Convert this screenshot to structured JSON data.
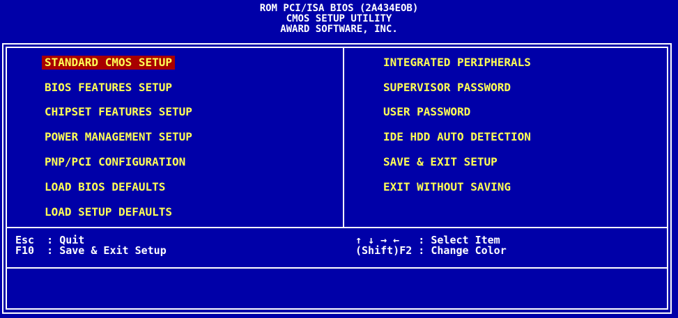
{
  "header": {
    "line1": "ROM PCI/ISA BIOS (2A434EOB)",
    "line2": "CMOS SETUP UTILITY",
    "line3": "AWARD SOFTWARE, INC."
  },
  "menu": {
    "left": [
      {
        "label": "STANDARD CMOS SETUP",
        "selected": true
      },
      {
        "label": "BIOS FEATURES SETUP"
      },
      {
        "label": "CHIPSET FEATURES SETUP"
      },
      {
        "label": "POWER MANAGEMENT SETUP"
      },
      {
        "label": "PNP/PCI CONFIGURATION"
      },
      {
        "label": "LOAD BIOS DEFAULTS"
      },
      {
        "label": "LOAD SETUP DEFAULTS"
      }
    ],
    "right": [
      {
        "label": "INTEGRATED PERIPHERALS"
      },
      {
        "label": "SUPERVISOR PASSWORD"
      },
      {
        "label": "USER PASSWORD"
      },
      {
        "label": "IDE HDD AUTO DETECTION"
      },
      {
        "label": "SAVE & EXIT SETUP"
      },
      {
        "label": "EXIT WITHOUT SAVING"
      }
    ]
  },
  "help": {
    "esc": "Esc  : Quit",
    "f10": "F10  : Save & Exit Setup",
    "arrows": "↑ ↓ → ←   : Select Item",
    "shift_f2": "(Shift)F2 : Change Color"
  },
  "colors": {
    "background": "#0000a8",
    "menu_text": "#ffff55",
    "selected_bg": "#a80000",
    "frame": "#ffffff"
  },
  "description_line": ""
}
